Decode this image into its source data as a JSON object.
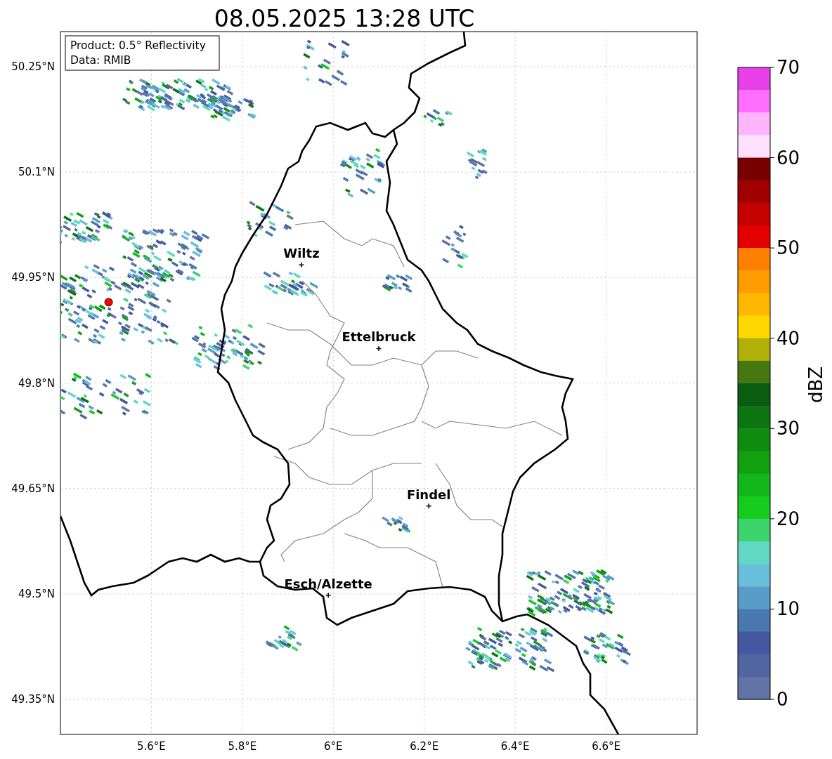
{
  "title": "08.05.2025 13:28 UTC",
  "info_box": [
    "Product: 0.5° Reflectivity",
    "Data: RMIB"
  ],
  "map": {
    "y_tick_labels": [
      "50.25°N",
      "50.1°N",
      "49.95°N",
      "49.8°N",
      "49.65°N",
      "49.5°N",
      "49.35°N"
    ],
    "x_tick_labels": [
      "5.6°E",
      "5.8°E",
      "6°E",
      "6.2°E",
      "6.4°E",
      "6.6°E"
    ],
    "cities": [
      "Wiltz",
      "Ettelbruck",
      "Findel",
      "Esch/Alzette"
    ]
  },
  "colorbar": {
    "label": "dBZ",
    "ticks": [
      "70",
      "60",
      "50",
      "40",
      "30",
      "20",
      "10",
      "0"
    ],
    "segments": [
      {
        "color": "#e840e8"
      },
      {
        "color": "#ff6eff"
      },
      {
        "color": "#ffb4ff"
      },
      {
        "color": "#ffe0ff"
      },
      {
        "color": "#780000"
      },
      {
        "color": "#a00000"
      },
      {
        "color": "#c40000"
      },
      {
        "color": "#e40000"
      },
      {
        "color": "#ff8000"
      },
      {
        "color": "#ff9c00"
      },
      {
        "color": "#ffb800"
      },
      {
        "color": "#ffd800"
      },
      {
        "color": "#b0b008"
      },
      {
        "color": "#467812"
      },
      {
        "color": "#0a5c10"
      },
      {
        "color": "#0c7410"
      },
      {
        "color": "#0e8c10"
      },
      {
        "color": "#10a010"
      },
      {
        "color": "#12b81a"
      },
      {
        "color": "#14cc1e"
      },
      {
        "color": "#3ed46c"
      },
      {
        "color": "#60d8c4"
      },
      {
        "color": "#68c0dc"
      },
      {
        "color": "#5a9cc8"
      },
      {
        "color": "#4a78b0"
      },
      {
        "color": "#4458a0"
      },
      {
        "color": "#5066a0"
      },
      {
        "color": "#6272a4"
      }
    ]
  }
}
